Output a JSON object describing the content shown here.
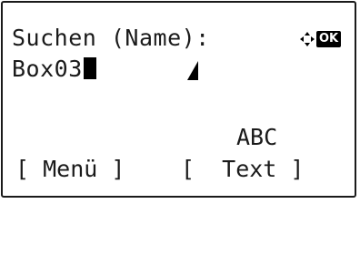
{
  "screen": {
    "title": "Suchen (Name):",
    "input_value": "Box03",
    "nav_ok_label": "OK",
    "input_mode": "ABC"
  },
  "softkeys": {
    "left_label": "[ Menü ]",
    "right_label": "[  Text ]"
  },
  "icons": {
    "nav": "dpad-arrows-icon",
    "ok": "ok-key-icon",
    "cursor": "text-cursor-block",
    "mark": "triangle-marker-icon"
  }
}
